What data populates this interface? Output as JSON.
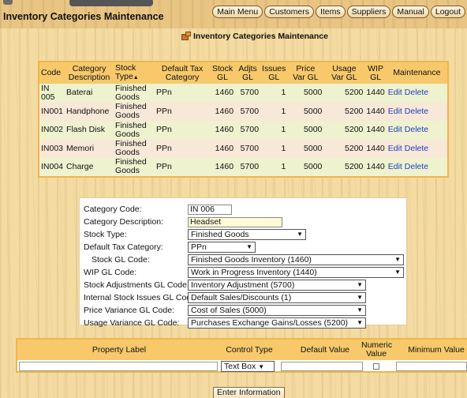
{
  "app": {
    "title": "Inventory Categories Maintenance"
  },
  "nav": {
    "items": [
      "Main Menu",
      "Customers",
      "Items",
      "Suppliers",
      "Manual",
      "Logout"
    ]
  },
  "page": {
    "heading": "Inventory Categories Maintenance"
  },
  "table": {
    "headers": [
      "Code",
      "Category Description",
      "Stock Type",
      "Default Tax Category",
      "Stock GL",
      "Adjts GL",
      "Issues GL",
      "Price Var GL",
      "Usage Var GL",
      "WIP GL",
      "Maintenance"
    ],
    "rows": [
      {
        "code": "IN 005",
        "desc": "Baterai",
        "type": "Finished Goods",
        "tax": "PPn",
        "stock": "1460",
        "adjts": "5700",
        "issues": "1",
        "pricevar": "5000",
        "usagevar": "5200",
        "wip": "1440",
        "edit": "Edit",
        "delete": "Delete"
      },
      {
        "code": "IN001",
        "desc": "Handphone",
        "type": "Finished Goods",
        "tax": "PPn",
        "stock": "1460",
        "adjts": "5700",
        "issues": "1",
        "pricevar": "5000",
        "usagevar": "5200",
        "wip": "1440",
        "edit": "Edit",
        "delete": "Delete"
      },
      {
        "code": "IN002",
        "desc": "Flash Disk",
        "type": "Finished Goods",
        "tax": "PPn",
        "stock": "1460",
        "adjts": "5700",
        "issues": "1",
        "pricevar": "5000",
        "usagevar": "5200",
        "wip": "1440",
        "edit": "Edit",
        "delete": "Delete"
      },
      {
        "code": "IN003",
        "desc": "Memori",
        "type": "Finished Goods",
        "tax": "PPn",
        "stock": "1460",
        "adjts": "5700",
        "issues": "1",
        "pricevar": "5000",
        "usagevar": "5200",
        "wip": "1440",
        "edit": "Edit",
        "delete": "Delete"
      },
      {
        "code": "IN004",
        "desc": "Charge",
        "type": "Finished Goods",
        "tax": "PPn",
        "stock": "1460",
        "adjts": "5700",
        "issues": "1",
        "pricevar": "5000",
        "usagevar": "5200",
        "wip": "1440",
        "edit": "Edit",
        "delete": "Delete"
      }
    ]
  },
  "form": {
    "category_code": {
      "label": "Category Code:",
      "value": "IN 006"
    },
    "category_description": {
      "label": "Category Description:",
      "value": "Headset"
    },
    "stock_type": {
      "label": "Stock Type:",
      "value": "Finished Goods"
    },
    "tax_category": {
      "label": "Default Tax Category:",
      "value": "PPn"
    },
    "stock_gl": {
      "label": "Stock GL Code:",
      "value": "Finished Goods Inventory (1460)"
    },
    "wip_gl": {
      "label": "WIP GL Code:",
      "value": "Work in Progress Inventory (1440)"
    },
    "adjustments_gl": {
      "label": "Stock Adjustments GL Code:",
      "value": "Inventory Adjustment (5700)"
    },
    "issues_gl": {
      "label": "Internal Stock Issues GL Code:",
      "value": "Default Sales/Discounts (1)"
    },
    "price_var_gl": {
      "label": "Price Variance GL Code:",
      "value": "Cost of Sales (5000)"
    },
    "usage_var_gl": {
      "label": "Usage Variance GL Code:",
      "value": "Purchases Exchange Gains/Losses (5200)"
    }
  },
  "properties": {
    "headers": {
      "label": "Property Label",
      "control": "Control Type",
      "default": "Default Value",
      "numeric": "Numeric Value",
      "minimum": "Minimum Value"
    },
    "control_value": "Text Box"
  },
  "actions": {
    "enter": "Enter Information"
  },
  "colors": {
    "header_bg": "#f7c96b",
    "border": "#f0b64a",
    "link": "#1f3fbf",
    "row_odd": "#eef2cf",
    "row_even": "#f8e8d8"
  },
  "icons": {
    "heading": "package-icon",
    "sort": "sort-arrow-icon",
    "dropdown": "dropdown-arrow-icon"
  }
}
